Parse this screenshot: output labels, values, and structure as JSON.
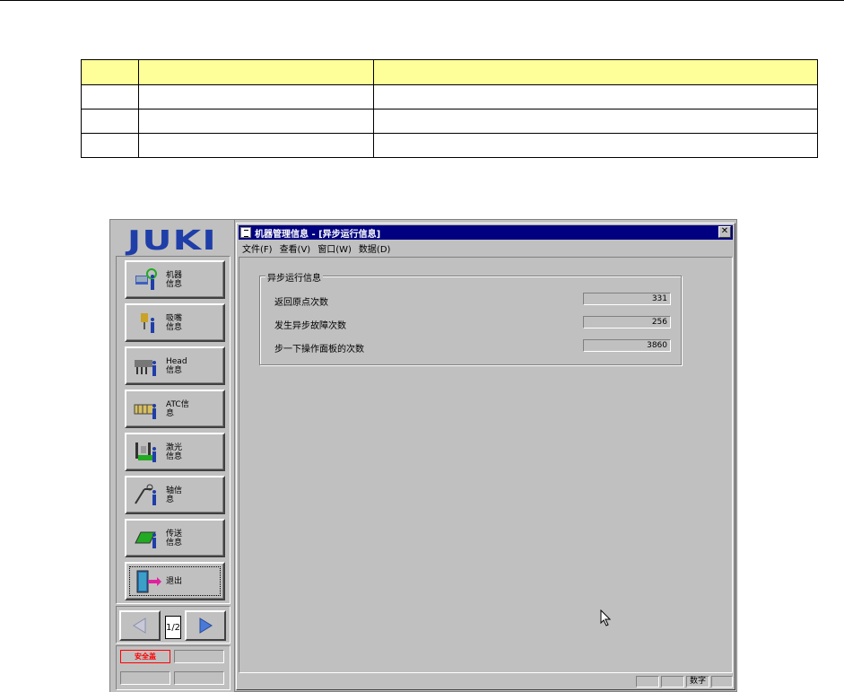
{
  "doc_table": {
    "rows": [
      [
        "",
        "",
        ""
      ],
      [
        "",
        "",
        ""
      ],
      [
        "",
        "",
        ""
      ],
      [
        "",
        "",
        ""
      ]
    ],
    "header_color": "#ffff99"
  },
  "app": {
    "logo": "JUKI",
    "menu": [
      {
        "label": "机器信息",
        "icon": "machine-info-icon"
      },
      {
        "label": "吸嘴信息",
        "icon": "nozzle-info-icon"
      },
      {
        "label": "Head信息",
        "icon": "head-info-icon"
      },
      {
        "label": "ATC信息",
        "icon": "atc-info-icon"
      },
      {
        "label": "激光信息",
        "icon": "laser-info-icon"
      },
      {
        "label": "轴信息",
        "icon": "axis-info-icon"
      },
      {
        "label": "传送信息",
        "icon": "conveyor-info-icon"
      },
      {
        "label": "退出",
        "icon": "exit-door-icon"
      }
    ],
    "pager": {
      "page": "1/2"
    },
    "safety_label": "安全盖",
    "window": {
      "title": "机器管理信息 - [异步运行信息]",
      "close": "✕",
      "menus": [
        "文件(F)",
        "查看(V)",
        "窗口(W)",
        "数据(D)"
      ],
      "group_title": "异步运行信息",
      "rows": [
        {
          "label": "返回原点次数",
          "value": "331"
        },
        {
          "label": "发生异步故障次数",
          "value": "256"
        },
        {
          "label": "步一下操作面板的次数",
          "value": "3860"
        }
      ],
      "status_cells": [
        "",
        "",
        "数字",
        ""
      ]
    },
    "colors": {
      "titlebar": "#000080",
      "logo": "#1f3ea8",
      "face": "#c0c0c0",
      "safety": "#ff0000"
    }
  }
}
